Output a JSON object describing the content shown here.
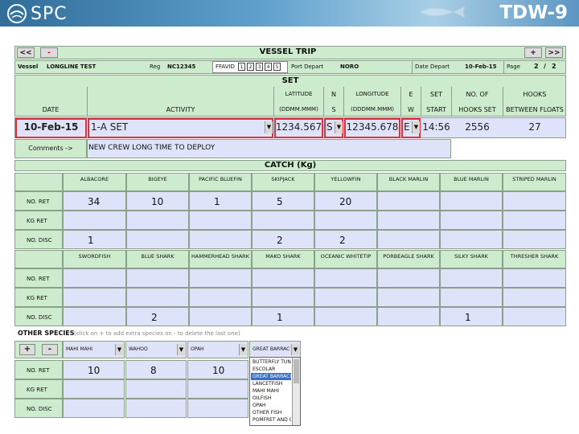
{
  "banner": {
    "logo": "SPC",
    "title": "TDW-9"
  },
  "trip": {
    "prev": "<<",
    "minus": "-",
    "title": "VESSEL TRIP",
    "plus": "+",
    "next": ">>",
    "vessel_label": "Vessel",
    "vessel": "LONGLINE TEST",
    "reg_label": "Reg",
    "reg": "NC12345",
    "ffavid_label": "FFAVID",
    "ffavid_boxes": [
      "1",
      "2",
      "3",
      "4",
      "5"
    ],
    "port_label": "Port Depart",
    "port": "NORO",
    "date_label": "Date Depart",
    "date": "10-Feb-15",
    "page_label": "Page",
    "page": "2",
    "page_sep": "/",
    "page_total": "2"
  },
  "set": {
    "title": "SET",
    "headers": {
      "date": "DATE",
      "activity": "ACTIVITY",
      "lat1": "LATITUDE",
      "lat2": "(DDMM.MMM)",
      "ns1": "N",
      "ns2": "S",
      "lon1": "LONGITUDE",
      "lon2": "(DDDMM.MMM)",
      "ew1": "E",
      "ew2": "W",
      "start1": "SET",
      "start2": "START",
      "hooks1": "NO. OF",
      "hooks2": "HOOKS SET",
      "floats1": "HOOKS",
      "floats2": "BETWEEN FLOATS"
    },
    "row": {
      "date": "10-Feb-15",
      "activity": "1-A SET",
      "lat": "1234.567",
      "ns": "S",
      "lon": "12345.678",
      "ew": "E",
      "start": "14:56",
      "hooks": "2556",
      "floats": "27"
    },
    "comments_label": "Comments ->",
    "comments": "NEW CREW LONG TIME TO DEPLOY"
  },
  "catch": {
    "title": "CATCH (Kg)",
    "row_labels": [
      "NO. RET",
      "KG RET",
      "NO. DISC"
    ],
    "group1": {
      "species": [
        "ALBACORE",
        "BIGEYE",
        "PACIFIC BLUEFIN",
        "SKIPJACK",
        "YELLOWFIN",
        "BLACK MARLIN",
        "BLUE MARLIN",
        "STRIPED MARLIN"
      ],
      "no_ret": [
        "34",
        "10",
        "1",
        "5",
        "20",
        "",
        "",
        ""
      ],
      "kg_ret": [
        "",
        "",
        "",
        "",
        "",
        "",
        "",
        ""
      ],
      "no_disc": [
        "1",
        "",
        "",
        "2",
        "2",
        "",
        "",
        ""
      ]
    },
    "group2": {
      "species": [
        "SWORDFISH",
        "BLUE SHARK",
        "HAMMERHEAD SHARK",
        "MAKO SHARK",
        "OCEANIC WHITETIP",
        "PORBEAGLE SHARK",
        "SILKY SHARK",
        "THRESHER SHARK"
      ],
      "no_ret": [
        "",
        "",
        "",
        "",
        "",
        "",
        "",
        ""
      ],
      "kg_ret": [
        "",
        "",
        "",
        "",
        "",
        "",
        "",
        ""
      ],
      "no_disc": [
        "",
        "2",
        "",
        "1",
        "",
        "",
        "1",
        ""
      ]
    }
  },
  "other": {
    "title": "OTHER SPECIES",
    "hint": "(click on + to add extra species on - to delete the last one)",
    "plus": "+",
    "minus": "-",
    "species": [
      "MAHI MAHI",
      "WAHOO",
      "OPAH",
      "GREAT BARRACUDA"
    ],
    "no_ret": [
      "10",
      "8",
      "10"
    ],
    "dropdown_items": [
      "BUTTERFLY TUNA",
      "ESCOLAR",
      "GREAT BARRACUDA",
      "LANCETFISH",
      "MAHI MAHI",
      "OILFISH",
      "OPAH",
      "OTHER FISH",
      "POMFRET AND OTHER"
    ],
    "dropdown_selected": 2
  },
  "colors": {
    "green": "#cdeccd",
    "lavender": "#dfe3f9",
    "highlight": "#e0303a"
  }
}
